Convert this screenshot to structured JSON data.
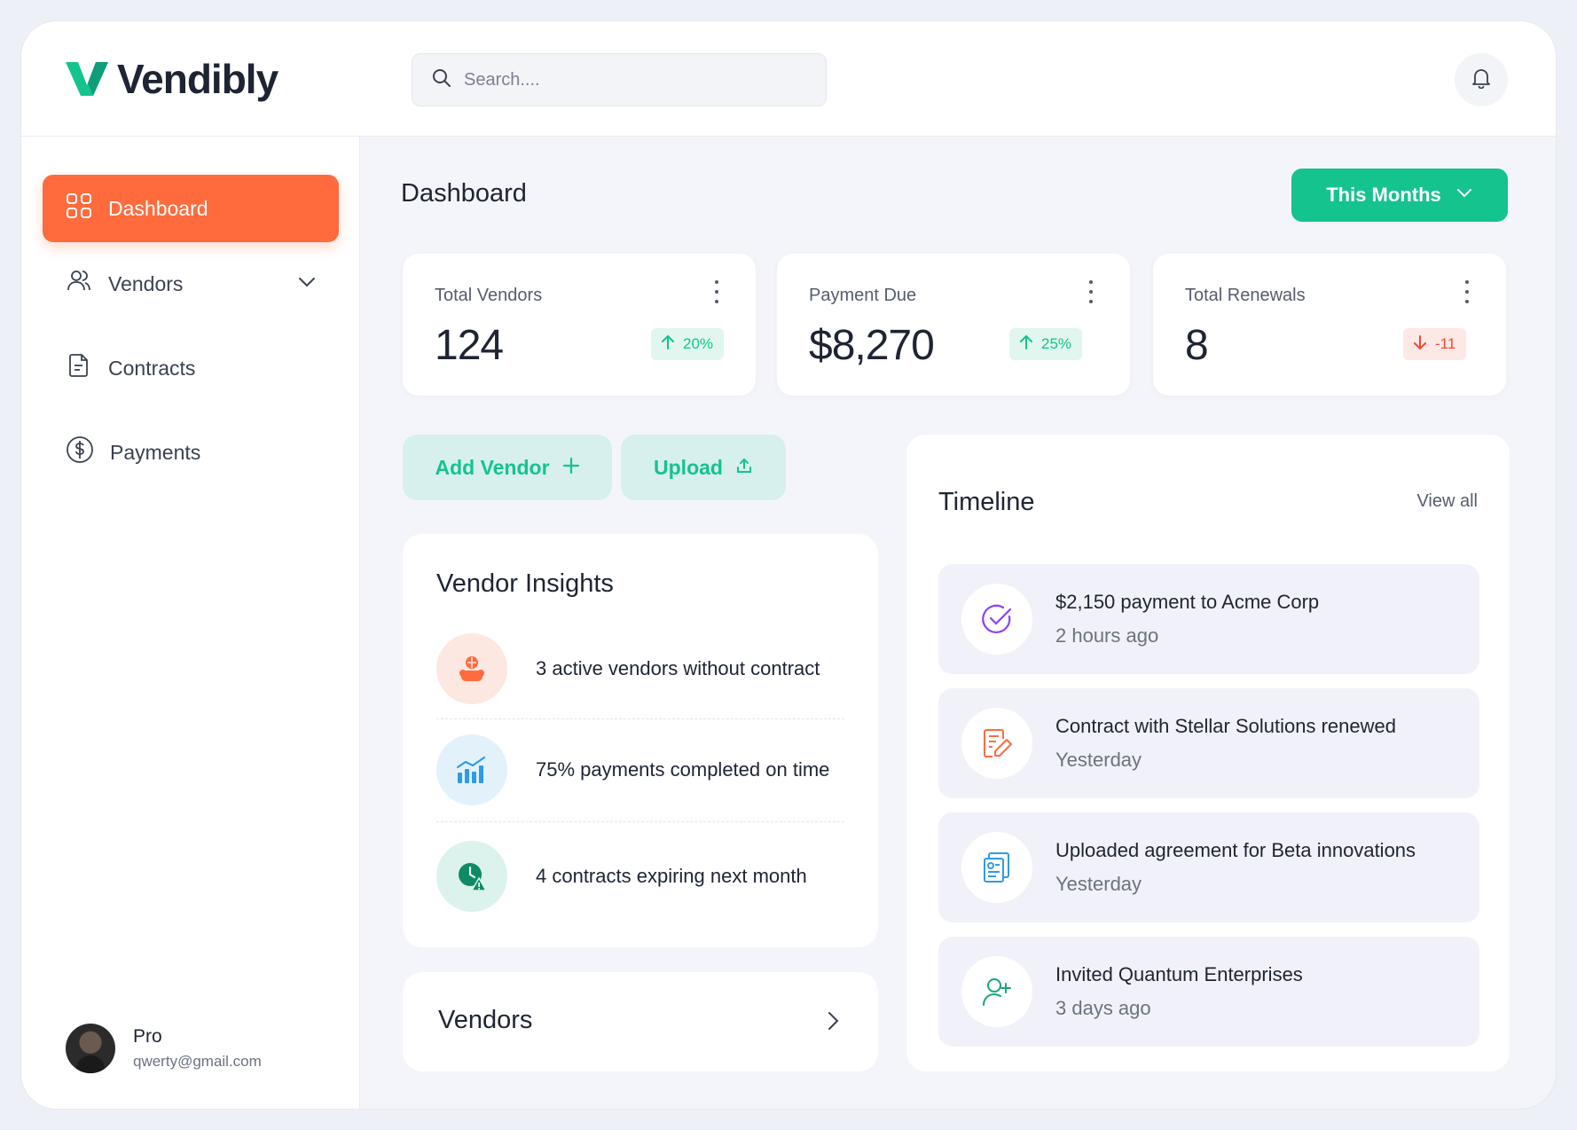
{
  "app": {
    "name": "Vendibly"
  },
  "search": {
    "placeholder": "Search...."
  },
  "sidebar": {
    "items": [
      {
        "label": "Dashboard",
        "icon": "grid-icon",
        "active": true
      },
      {
        "label": "Vendors",
        "icon": "users-icon",
        "active": false
      },
      {
        "label": "Contracts",
        "icon": "document-icon",
        "active": false
      },
      {
        "label": "Payments",
        "icon": "dollar-icon",
        "active": false
      }
    ]
  },
  "user": {
    "name": "Pro",
    "email": "qwerty@gmail.com"
  },
  "main": {
    "title": "Dashboard",
    "period_label": "This Months",
    "stats": [
      {
        "label": "Total Vendors",
        "value": "124",
        "change": "20%",
        "trend": "up"
      },
      {
        "label": "Payment Due",
        "value": "$8,270",
        "change": "25%",
        "trend": "up"
      },
      {
        "label": "Total Renewals",
        "value": "8",
        "change": "-11",
        "trend": "down"
      }
    ],
    "actions": {
      "add_vendor": "Add Vendor",
      "upload": "Upload"
    },
    "insights": {
      "title": "Vendor Insights",
      "items": [
        {
          "text": "3 active vendors without contract",
          "icon": "team-alert-icon"
        },
        {
          "text": "75% payments completed on time",
          "icon": "bar-chart-icon"
        },
        {
          "text": "4 contracts expiring next month",
          "icon": "clock-warning-icon"
        }
      ]
    },
    "vendors_card": {
      "title": "Vendors"
    },
    "timeline": {
      "title": "Timeline",
      "view_all": "View all",
      "items": [
        {
          "title": "$2,150 payment to Acme Corp",
          "time": "2 hours ago",
          "icon": "check-circle-icon"
        },
        {
          "title": "Contract with Stellar Solutions renewed",
          "time": "Yesterday",
          "icon": "contract-edit-icon"
        },
        {
          "title": "Uploaded agreement for Beta innovations",
          "time": "Yesterday",
          "icon": "agreement-icon"
        },
        {
          "title": "Invited Quantum Enterprises",
          "time": "3 days ago",
          "icon": "user-plus-icon"
        }
      ]
    }
  },
  "colors": {
    "accent_orange": "#ff6b3d",
    "accent_green": "#14c38e",
    "down_red": "#ef4b35"
  }
}
